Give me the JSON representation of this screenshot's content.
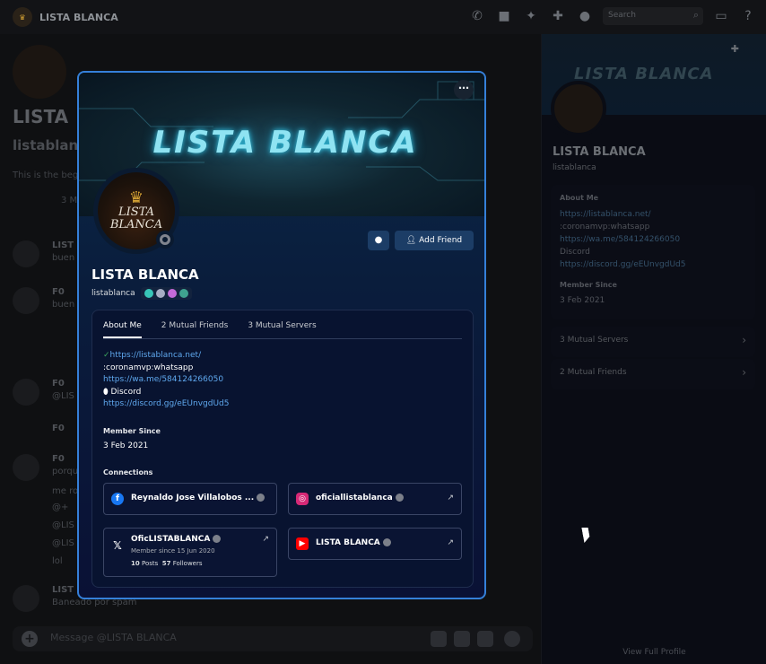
{
  "window": {
    "title": "LISTA BLANCA",
    "search_placeholder": "Search"
  },
  "chat": {
    "header_name": "LISTA",
    "header_username": "listablanc",
    "beginning_text": "This is the beg",
    "mutual_count": "3 M",
    "messages": [
      {
        "author": "LIST",
        "text": "buen"
      },
      {
        "author": "F0",
        "text": "buen"
      },
      {
        "author": "F0",
        "text": "@LIS"
      },
      {
        "author": "F0",
        "text": ""
      },
      {
        "author": "F0",
        "text": "porqu"
      },
      {
        "author": "",
        "text": "me ro"
      },
      {
        "author": "",
        "text": "@+"
      },
      {
        "author": "",
        "text": "@LIS"
      },
      {
        "author": "",
        "text": "@LIS"
      },
      {
        "author": "",
        "text": "lol"
      },
      {
        "author": "LIST",
        "text": "Baneado por spam"
      }
    ],
    "input_placeholder": "Message @LISTA BLANCA"
  },
  "side_profile": {
    "banner_text": "LISTA BLANCA",
    "name": "LISTA BLANCA",
    "username": "listablanca",
    "about_label": "About Me",
    "about_lines": [
      "https://listablanca.net/",
      ":coronamvp:whatsapp",
      "https://wa.me/584124266050",
      "Discord",
      "https://discord.gg/eEUnvgdUd5"
    ],
    "member_since_label": "Member Since",
    "member_since": "3 Feb 2021",
    "mutual_servers": "3 Mutual Servers",
    "mutual_friends": "2 Mutual Friends",
    "view_full": "View Full Profile"
  },
  "modal": {
    "banner_text": "LISTA BLANCA",
    "avatar_text_1": "LISTA",
    "avatar_text_2": "BLANCA",
    "add_friend": "Add Friend",
    "name": "LISTA BLANCA",
    "username": "listablanca",
    "tabs": [
      "About Me",
      "2 Mutual Friends",
      "3 Mutual Servers"
    ],
    "about": {
      "link1": "https://listablanca.net/",
      "line2": ":coronamvp:whatsapp",
      "link3": "https://wa.me/584124266050",
      "line4": "Discord",
      "link5": "https://discord.gg/eEUnvgdUd5"
    },
    "member_since_label": "Member Since",
    "member_since": "3 Feb 2021",
    "connections_label": "Connections",
    "connections": [
      {
        "service": "facebook",
        "name": "Reynaldo Jose Villalobos ..."
      },
      {
        "service": "instagram",
        "name": "oficiallistablanca"
      },
      {
        "service": "x",
        "name": "OficLISTABLANCA",
        "sub": "Member since 15 Jun 2020",
        "posts": "10",
        "posts_label": "Posts",
        "followers": "57",
        "followers_label": "Followers"
      },
      {
        "service": "youtube",
        "name": "LISTA BLANCA"
      }
    ]
  },
  "colors": {
    "accent": "#3580d9",
    "link": "#5fa8ee",
    "button": "#1c3d66"
  }
}
